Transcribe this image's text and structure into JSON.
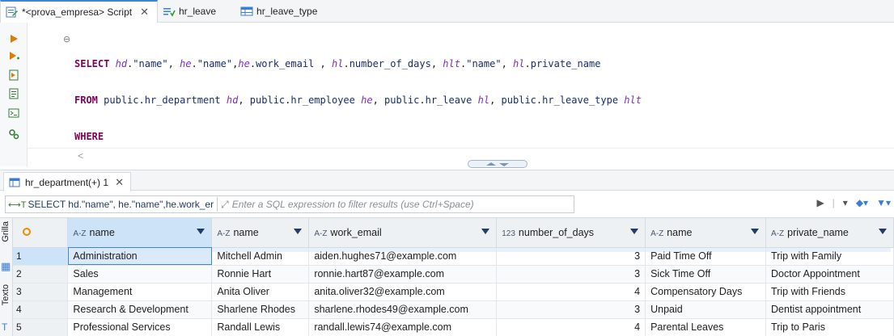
{
  "tabs": [
    {
      "label": "*<prova_empresa> Script",
      "icon": "sql-script-icon",
      "active": true
    },
    {
      "label": "hr_leave",
      "icon": "table-view-icon",
      "active": false
    },
    {
      "label": "hr_leave_type",
      "icon": "table-icon",
      "active": false
    }
  ],
  "toolbar_icons": [
    "execute-statement-icon",
    "execute-in-new-tab-icon",
    "execute-script-icon",
    "explain-plan-icon",
    "open-console-icon",
    "settings-icon"
  ],
  "results_tab": {
    "label": "hr_department(+) 1"
  },
  "filter": {
    "query_preview": "SELECT hd.\"name\", he.\"name\",he.work_er",
    "placeholder": "Enter a SQL expression to filter results (use Ctrl+Space)"
  },
  "side_tabs": {
    "grid": "Grilla",
    "text": "Texto"
  },
  "columns": [
    {
      "type": "A-Z",
      "name": "name"
    },
    {
      "type": "A-Z",
      "name": "name"
    },
    {
      "type": "A-Z",
      "name": "work_email"
    },
    {
      "type": "123",
      "name": "number_of_days"
    },
    {
      "type": "A-Z",
      "name": "name"
    },
    {
      "type": "A-Z",
      "name": "private_name"
    }
  ],
  "rows": [
    {
      "n": "1",
      "c1": "Administration",
      "c2": "Mitchell Admin",
      "c3": "aiden.hughes71@example.com",
      "c4": "3",
      "c5": "Paid Time Off",
      "c6": "Trip with Family"
    },
    {
      "n": "2",
      "c1": "Sales",
      "c2": "Ronnie Hart",
      "c3": "ronnie.hart87@example.com",
      "c4": "3",
      "c5": "Sick Time Off",
      "c6": "Doctor Appointment"
    },
    {
      "n": "3",
      "c1": "Management",
      "c2": "Anita Oliver",
      "c3": "anita.oliver32@example.com",
      "c4": "4",
      "c5": "Compensatory Days",
      "c6": "Trip with Friends"
    },
    {
      "n": "4",
      "c1": "Research & Development",
      "c2": "Sharlene Rhodes",
      "c3": "sharlene.rhodes49@example.com",
      "c4": "3",
      "c5": "Unpaid",
      "c6": "Dentist appointment"
    },
    {
      "n": "5",
      "c1": "Professional Services",
      "c2": "Randall Lewis",
      "c3": "randall.lewis74@example.com",
      "c4": "4",
      "c5": "Parental Leaves",
      "c6": "Trip to Paris"
    }
  ],
  "colors": {
    "keyword": "#7f0055",
    "alias": "#7a2fc4",
    "accent": "#3b86d6",
    "selection": "#cde3f7"
  }
}
